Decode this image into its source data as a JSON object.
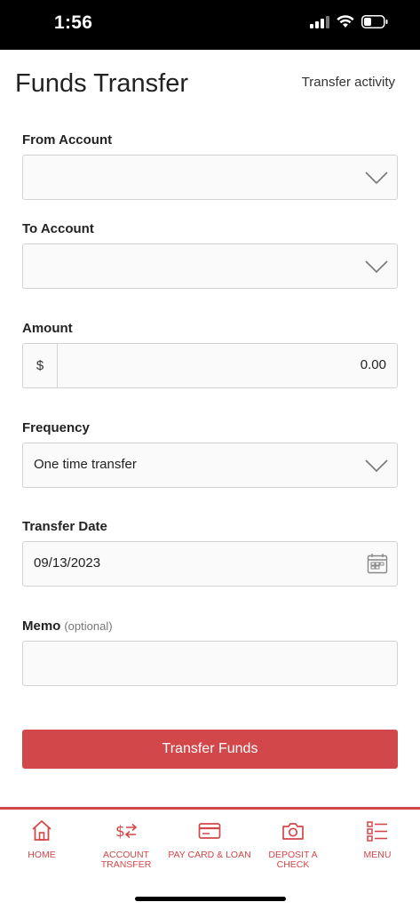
{
  "status": {
    "time": "1:56"
  },
  "header": {
    "title": "Funds Transfer",
    "activity_link": "Transfer activity"
  },
  "form": {
    "from_account": {
      "label": "From Account",
      "value": ""
    },
    "to_account": {
      "label": "To Account",
      "value": ""
    },
    "amount": {
      "label": "Amount",
      "prefix": "$",
      "value": "0.00"
    },
    "frequency": {
      "label": "Frequency",
      "value": "One time transfer"
    },
    "transfer_date": {
      "label": "Transfer Date",
      "value": "09/13/2023"
    },
    "memo": {
      "label": "Memo",
      "optional": "(optional)",
      "value": ""
    },
    "submit_label": "Transfer Funds"
  },
  "tabs": [
    {
      "label": "HOME",
      "icon": "home-icon"
    },
    {
      "label": "ACCOUNT TRANSFER",
      "icon": "transfer-icon"
    },
    {
      "label": "PAY CARD & LOAN",
      "icon": "credit-card-icon"
    },
    {
      "label": "DEPOSIT A CHECK",
      "icon": "camera-icon"
    },
    {
      "label": "MENU",
      "icon": "menu-list-icon"
    }
  ],
  "colors": {
    "accent": "#d2474a",
    "border": "#d3d3d3",
    "field_bg": "#fafafa"
  }
}
